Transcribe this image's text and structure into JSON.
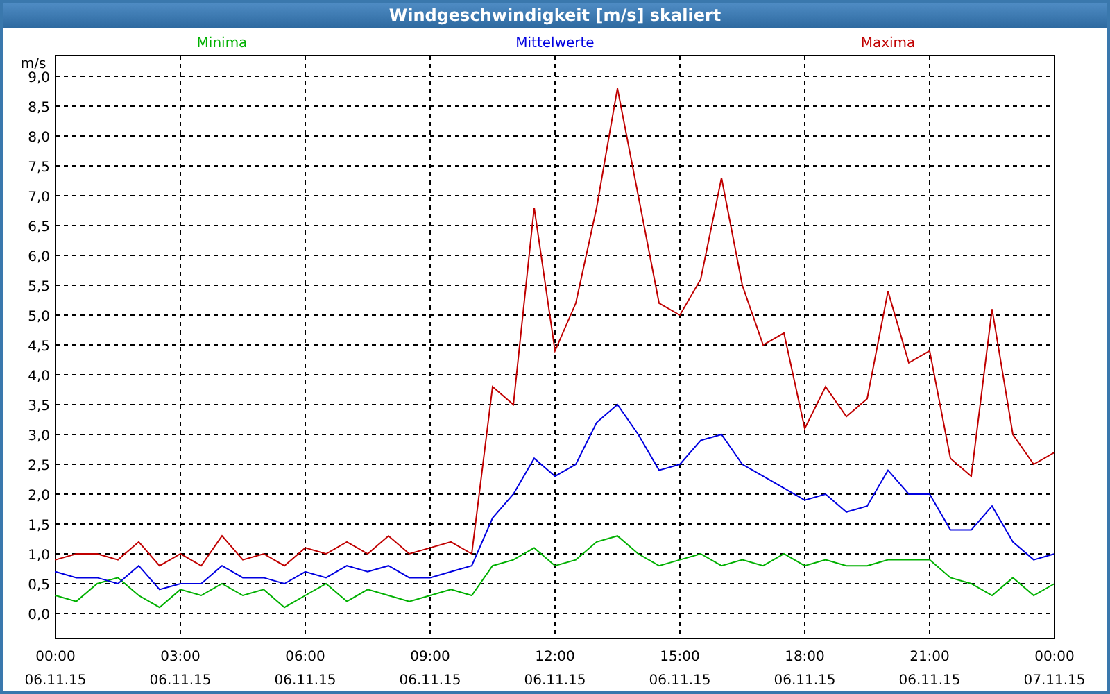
{
  "window": {
    "title": "Windgeschwindigkeit [m/s] skaliert"
  },
  "chart": {
    "chart_data": {
      "type": "line",
      "grid": true,
      "ylabel": "m/s",
      "ylim": [
        -0.42,
        9.35
      ],
      "categories": [
        "00:00 06.11.15",
        null,
        null,
        null,
        null,
        null,
        "03:00 06.11.15",
        null,
        null,
        null,
        null,
        null,
        "06:00 06.11.15",
        null,
        null,
        null,
        null,
        null,
        "09:00 06.11.15",
        null,
        null,
        null,
        null,
        null,
        "12:00 06.11.15",
        null,
        null,
        null,
        null,
        null,
        "15:00 06.11.15",
        null,
        null,
        null,
        null,
        null,
        "18:00 06.11.15",
        null,
        null,
        null,
        null,
        null,
        "21:00 06.11.15",
        null,
        null,
        null,
        null,
        null,
        "00:00 07.11.15"
      ],
      "series": [
        {
          "name": "Minima",
          "color": "#00b000",
          "values": [
            0.3,
            0.2,
            0.5,
            0.6,
            0.3,
            0.1,
            0.4,
            0.3,
            0.5,
            0.3,
            0.4,
            0.1,
            0.3,
            0.5,
            0.2,
            0.4,
            0.3,
            0.2,
            0.3,
            0.4,
            0.3,
            0.8,
            0.9,
            1.1,
            0.8,
            0.9,
            1.2,
            1.3,
            1.0,
            0.8,
            0.9,
            1.0,
            0.8,
            0.9,
            0.8,
            1.0,
            0.8,
            0.9,
            0.8,
            0.8,
            0.9,
            0.9,
            0.9,
            0.6,
            0.5,
            0.3,
            0.6,
            0.3,
            0.5
          ]
        },
        {
          "name": "Mittelwerte",
          "color": "#0000e0",
          "values": [
            0.7,
            0.6,
            0.6,
            0.5,
            0.8,
            0.4,
            0.5,
            0.5,
            0.8,
            0.6,
            0.6,
            0.5,
            0.7,
            0.6,
            0.8,
            0.7,
            0.8,
            0.6,
            0.6,
            0.7,
            0.8,
            1.6,
            2.0,
            2.6,
            2.3,
            2.5,
            3.2,
            3.5,
            3.0,
            2.4,
            2.5,
            2.9,
            3.0,
            2.5,
            2.3,
            2.1,
            1.9,
            2.0,
            1.7,
            1.8,
            2.4,
            2.0,
            2.0,
            1.4,
            1.4,
            1.8,
            1.2,
            0.9,
            1.0
          ]
        },
        {
          "name": "Maxima",
          "color": "#c00000",
          "values": [
            0.9,
            1.0,
            1.0,
            0.9,
            1.2,
            0.8,
            1.0,
            0.8,
            1.3,
            0.9,
            1.0,
            0.8,
            1.1,
            1.0,
            1.2,
            1.0,
            1.3,
            1.0,
            1.1,
            1.2,
            1.0,
            3.8,
            3.5,
            6.8,
            4.4,
            5.2,
            6.8,
            8.8,
            7.0,
            5.2,
            5.0,
            5.6,
            7.3,
            5.5,
            4.5,
            4.7,
            3.1,
            3.8,
            3.3,
            3.6,
            5.4,
            4.2,
            4.4,
            2.6,
            2.3,
            5.1,
            3.0,
            2.5,
            2.7
          ]
        }
      ],
      "yticks": [
        {
          "value": 0,
          "label": "0,0"
        },
        {
          "value": 0.5,
          "label": "0,5"
        },
        {
          "value": 1,
          "label": "1,0"
        },
        {
          "value": 1.5,
          "label": "1,5"
        },
        {
          "value": 2,
          "label": "2,0"
        },
        {
          "value": 2.5,
          "label": "2,5"
        },
        {
          "value": 3,
          "label": "3,0"
        },
        {
          "value": 3.5,
          "label": "3,5"
        },
        {
          "value": 4,
          "label": "4,0"
        },
        {
          "value": 4.5,
          "label": "4,5"
        },
        {
          "value": 5,
          "label": "5,0"
        },
        {
          "value": 5.5,
          "label": "5,5"
        },
        {
          "value": 6,
          "label": "6,0"
        },
        {
          "value": 6.5,
          "label": "6,5"
        },
        {
          "value": 7,
          "label": "7,0"
        },
        {
          "value": 7.5,
          "label": "7,5"
        },
        {
          "value": 8,
          "label": "8,0"
        },
        {
          "value": 8.5,
          "label": "8,5"
        },
        {
          "value": 9,
          "label": "9,0"
        }
      ]
    }
  }
}
